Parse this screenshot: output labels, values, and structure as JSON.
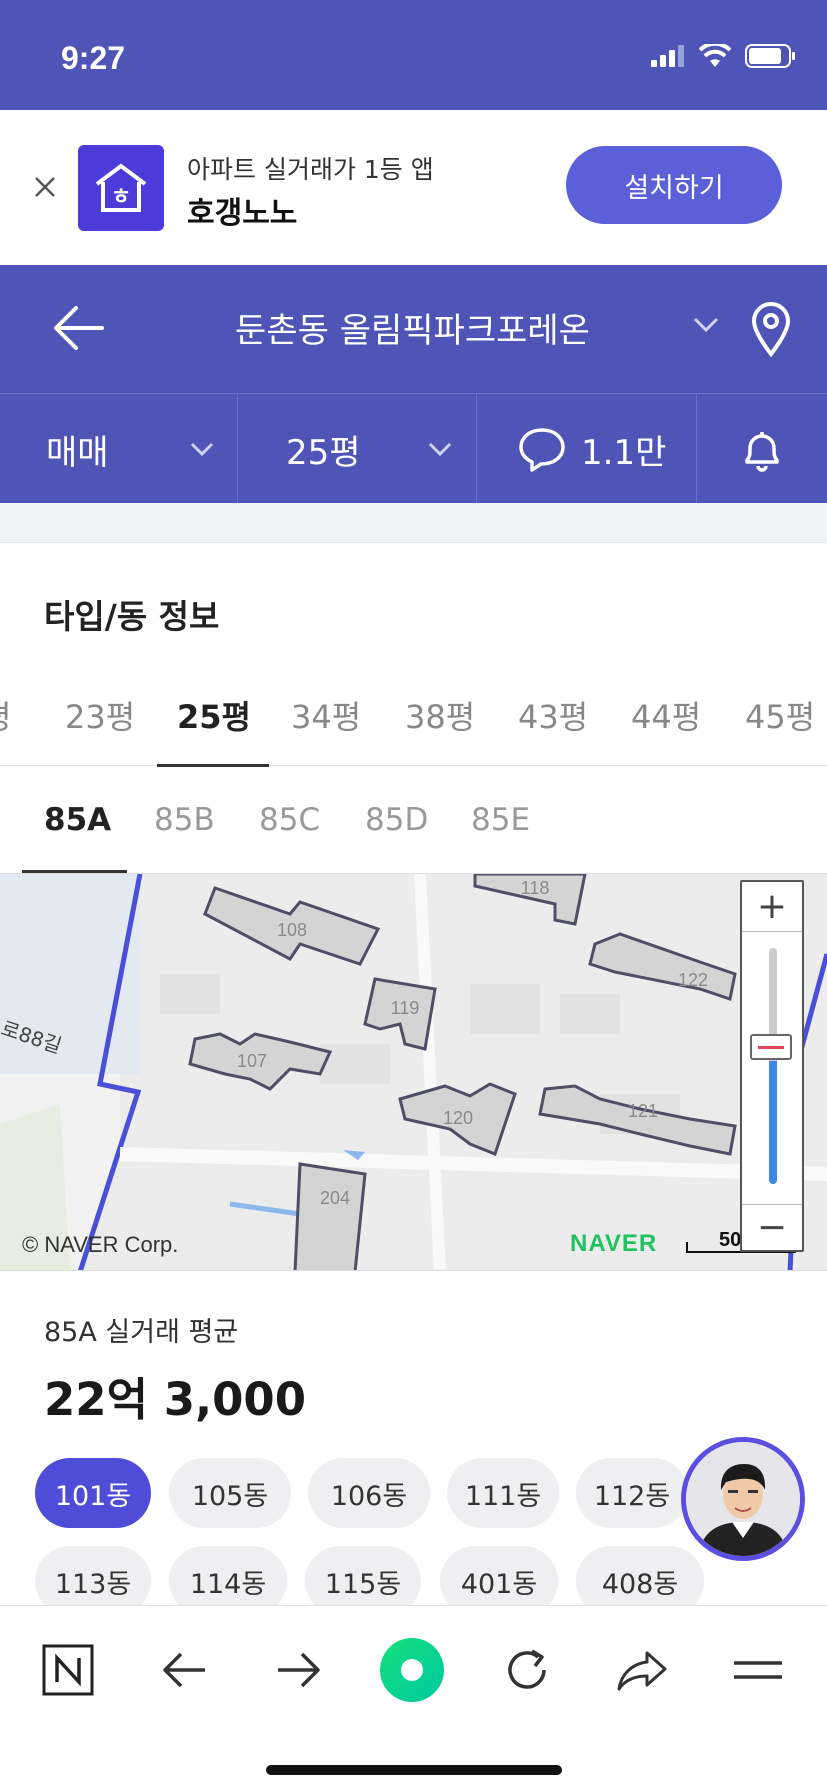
{
  "status_bar": {
    "time": "9:27",
    "icons": [
      "signal-icon",
      "wifi-icon",
      "battery-icon"
    ]
  },
  "app_banner": {
    "subtitle": "아파트 실거래가 1등 앱",
    "title": "호갱노노",
    "install_label": "설치하기",
    "logo_text": "ㅎ"
  },
  "header": {
    "title": "둔촌동 올림픽파크포레온"
  },
  "filters": {
    "deal_type": "매매",
    "size": "25평",
    "comments": "1.1만"
  },
  "section": {
    "title": "타입/동 정보"
  },
  "size_tabs": [
    {
      "label": "평"
    },
    {
      "label": "23평"
    },
    {
      "label": "25평",
      "active": true
    },
    {
      "label": "34평"
    },
    {
      "label": "38평"
    },
    {
      "label": "43평"
    },
    {
      "label": "44평"
    },
    {
      "label": "45평"
    }
  ],
  "type_tabs": [
    {
      "label": "85A",
      "active": true
    },
    {
      "label": "85B"
    },
    {
      "label": "85C"
    },
    {
      "label": "85D"
    },
    {
      "label": "85E"
    }
  ],
  "map": {
    "copyright": "© NAVER Corp.",
    "brand": "NAVER",
    "scale": "50",
    "road_label": "로88길",
    "buildings": [
      "108",
      "118",
      "119",
      "122",
      "107",
      "120",
      "121",
      "204"
    ],
    "zoom_in": "+",
    "zoom_out": "−",
    "zoom_level": 0.52
  },
  "price": {
    "label": "85A 실거래 평균",
    "value": "22억 3,000"
  },
  "dong_chips": [
    "101동",
    "105동",
    "106동",
    "111동",
    "112동",
    "113동",
    "114동",
    "115동",
    "401동",
    "408동"
  ],
  "colors": {
    "brand": "#4E55B6",
    "accent": "#4F4DD8",
    "naver_green": "#1FC25E"
  }
}
